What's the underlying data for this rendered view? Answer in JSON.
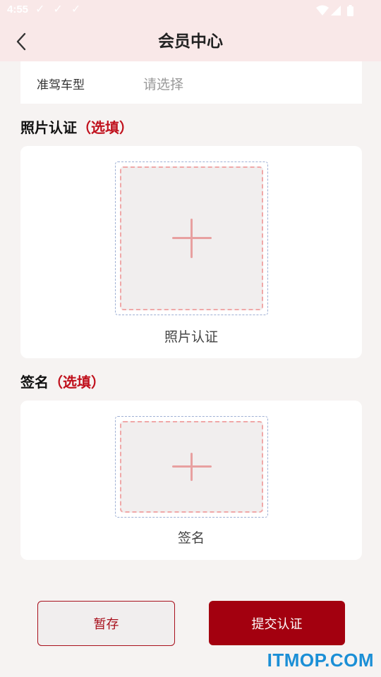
{
  "status_bar": {
    "time": "4:55",
    "checks": "✓✓✓"
  },
  "header": {
    "title": "会员中心"
  },
  "form": {
    "driving_type_label": "准驾车型",
    "driving_type_placeholder": "请选择"
  },
  "photo_section": {
    "title": "照片认证",
    "optional": "（选填）",
    "caption": "照片认证"
  },
  "signature_section": {
    "title": "签名",
    "optional": "（选填）",
    "caption": "签名"
  },
  "actions": {
    "save_label": "暂存",
    "submit_label": "提交认证"
  },
  "watermark": "ITMOP.COM",
  "colors": {
    "header_bg": "#f9e8e8",
    "accent": "#a3000f",
    "optional_text": "#c0101c",
    "plus": "#e8a0a0"
  }
}
